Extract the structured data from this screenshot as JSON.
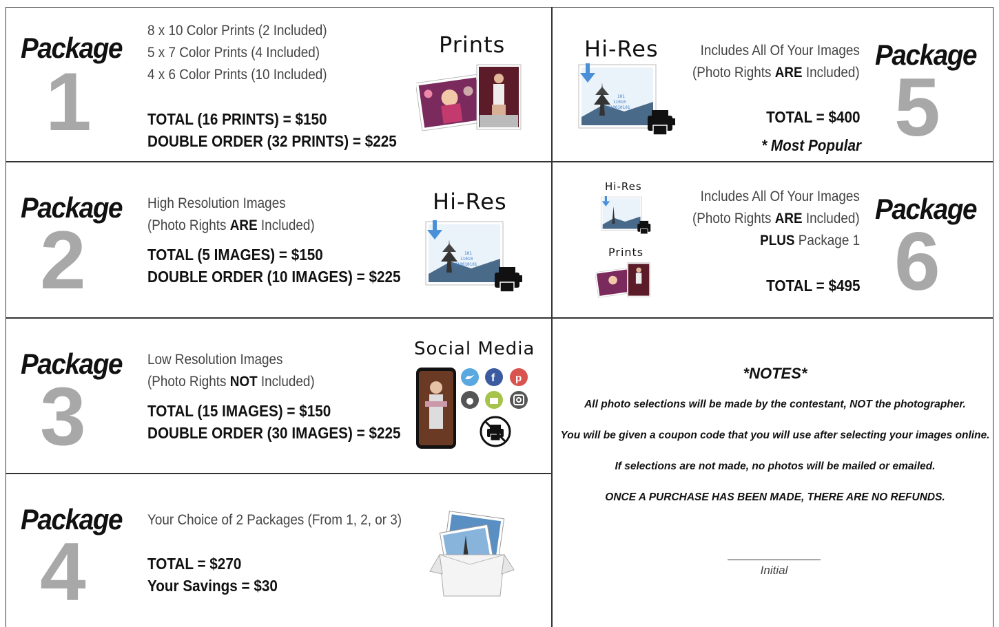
{
  "packages": {
    "p1": {
      "word": "Package",
      "num": "1",
      "lines": [
        "8 x 10 Color Prints (2 Included)",
        "5 x 7 Color Prints (4 Included)",
        "4 x 6 Color Prints (10 Included)"
      ],
      "total": "TOTAL (16 PRINTS) = $150",
      "double": "DOUBLE ORDER (32 PRINTS) = $225",
      "graphic_label": "Prints"
    },
    "p2": {
      "word": "Package",
      "num": "2",
      "line1": "High Resolution Images",
      "rights_pre": "(Photo Rights ",
      "rights_bold": "ARE",
      "rights_post": " Included)",
      "total": "TOTAL (5 IMAGES) = $150",
      "double": "DOUBLE ORDER (10 IMAGES) = $225",
      "graphic_label": "Hi-Res"
    },
    "p3": {
      "word": "Package",
      "num": "3",
      "line1": "Low Resolution Images",
      "rights_pre": "(Photo Rights ",
      "rights_bold": "NOT",
      "rights_post": " Included)",
      "total": "TOTAL (15 IMAGES) = $150",
      "double": "DOUBLE ORDER (30 IMAGES) = $225",
      "graphic_label": "Social Media"
    },
    "p4": {
      "word": "Package",
      "num": "4",
      "line1": "Your Choice of 2 Packages (From 1, 2, or 3)",
      "total": "TOTAL = $270",
      "savings": "Your Savings = $30"
    },
    "p5": {
      "word": "Package",
      "num": "5",
      "line1": "Includes All Of Your Images",
      "rights_pre": "(Photo Rights ",
      "rights_bold": "ARE",
      "rights_post": " Included)",
      "total": "TOTAL = $400",
      "popular": "* Most Popular",
      "graphic_label": "Hi-Res"
    },
    "p6": {
      "word": "Package",
      "num": "6",
      "line1": "Includes All Of Your Images",
      "rights_pre": "(Photo Rights ",
      "rights_bold": "ARE",
      "rights_post": " Included)",
      "plus_bold": "PLUS",
      "plus_rest": " Package 1",
      "total": "TOTAL = $495",
      "graphic_label_hires": "Hi-Res",
      "graphic_label_prints": "Prints"
    }
  },
  "notes": {
    "title": "*NOTES*",
    "items": [
      "All photo selections will be made by the contestant, NOT the photographer.",
      "You will be given a coupon code that you will use after selecting your images online.",
      "If selections are not made, no photos will be mailed or emailed.",
      "ONCE A PURCHASE HAS BEEN MADE, THERE ARE NO REFUNDS."
    ],
    "initial_label": "Initial"
  },
  "colors": {
    "number_gray": "#a8a8a8",
    "border": "#333333",
    "accent_blue": "#4a90d9"
  },
  "social_icons": [
    "twitter-icon",
    "facebook-icon",
    "pinterest-icon",
    "apple-icon",
    "android-icon",
    "instagram-icon"
  ]
}
